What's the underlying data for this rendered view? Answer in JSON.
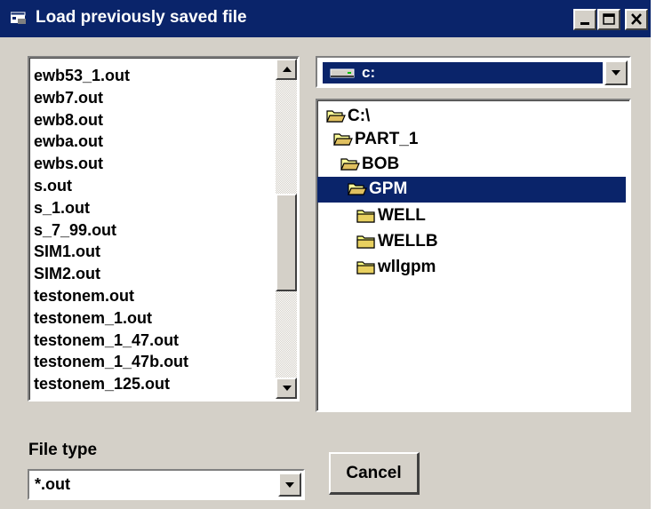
{
  "window": {
    "title": "Load previously saved file"
  },
  "file_list": {
    "items": [
      "ewb53_1.out",
      "ewb7.out",
      "ewb8.out",
      "ewba.out",
      "ewbs.out",
      "s.out",
      "s_1.out",
      "s_7_99.out",
      "SIM1.out",
      "SIM2.out",
      "testonem.out",
      "testonem_1.out",
      "testonem_1_47.out",
      "testonem_1_47b.out",
      "testonem_125.out"
    ]
  },
  "drive": {
    "selected": "c:"
  },
  "directory_tree": {
    "items": [
      {
        "label": "C:\\",
        "selected": false
      },
      {
        "label": "PART_1",
        "selected": false
      },
      {
        "label": "BOB",
        "selected": false
      },
      {
        "label": "GPM",
        "selected": true
      },
      {
        "label": "WELL",
        "selected": false
      },
      {
        "label": "WELLB",
        "selected": false
      },
      {
        "label": "wllgpm",
        "selected": false
      }
    ]
  },
  "file_type": {
    "label": "File type",
    "value": "*.out"
  },
  "buttons": {
    "cancel": "Cancel"
  },
  "colors": {
    "titlebar": "#0a246a",
    "selection": "#0a246a",
    "face": "#d4d0c8"
  },
  "icons": {
    "title": "app-icon",
    "folder": "folder-icon",
    "drive": "drive-icon"
  }
}
